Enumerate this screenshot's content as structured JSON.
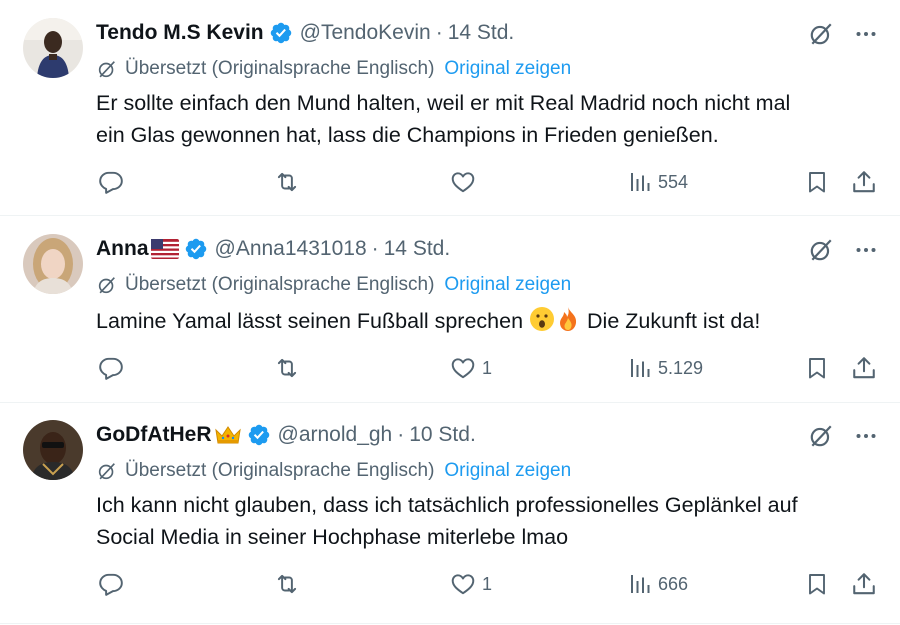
{
  "colors": {
    "text": "#0f1419",
    "secondary": "#536471",
    "link": "#1d9bf0",
    "verified": "#1d9bf0",
    "divider": "#eff3f4"
  },
  "tweets": [
    {
      "name": "Tendo M.S Kevin",
      "handle": "@TendoKevin",
      "separator": "·",
      "time": "14 Std.",
      "translated_label": "Übersetzt (Originalsprache Englisch)",
      "show_original": "Original zeigen",
      "text_lines": [
        "Er sollte einfach den Mund halten, weil er mit Real Madrid noch nicht mal",
        "ein Glas gewonnen hat, lass die Champions in Frieden genießen."
      ],
      "replies": "",
      "retweets": "",
      "likes": "",
      "views": "554"
    },
    {
      "name": "Anna",
      "name_emoji": "us-flag",
      "handle": "@Anna1431018",
      "separator": "·",
      "time": "14 Std.",
      "translated_label": "Übersetzt (Originalsprache Englisch)",
      "show_original": "Original zeigen",
      "text_before": "Lamine Yamal lässt seinen Fußball sprechen",
      "text_emojis": [
        "astonished-face",
        "fire"
      ],
      "text_after": "Die Zukunft ist da!",
      "replies": "",
      "retweets": "",
      "likes": "1",
      "views": "5.129"
    },
    {
      "name": "GoDfAtHeR",
      "name_emoji": "crown",
      "handle": "@arnold_gh",
      "separator": "·",
      "time": "10 Std.",
      "translated_label": "Übersetzt (Originalsprache Englisch)",
      "show_original": "Original zeigen",
      "text_lines": [
        "Ich kann nicht glauben, dass ich tatsächlich professionelles Geplänkel auf",
        "Social Media in seiner Hochphase miterlebe lmao"
      ],
      "replies": "",
      "retweets": "",
      "likes": "1",
      "views": "666"
    }
  ],
  "icons": [
    "verified-badge-icon",
    "grok-icon",
    "more-icon",
    "translate-icon",
    "reply-icon",
    "retweet-icon",
    "like-icon",
    "views-icon",
    "bookmark-icon",
    "share-icon"
  ]
}
